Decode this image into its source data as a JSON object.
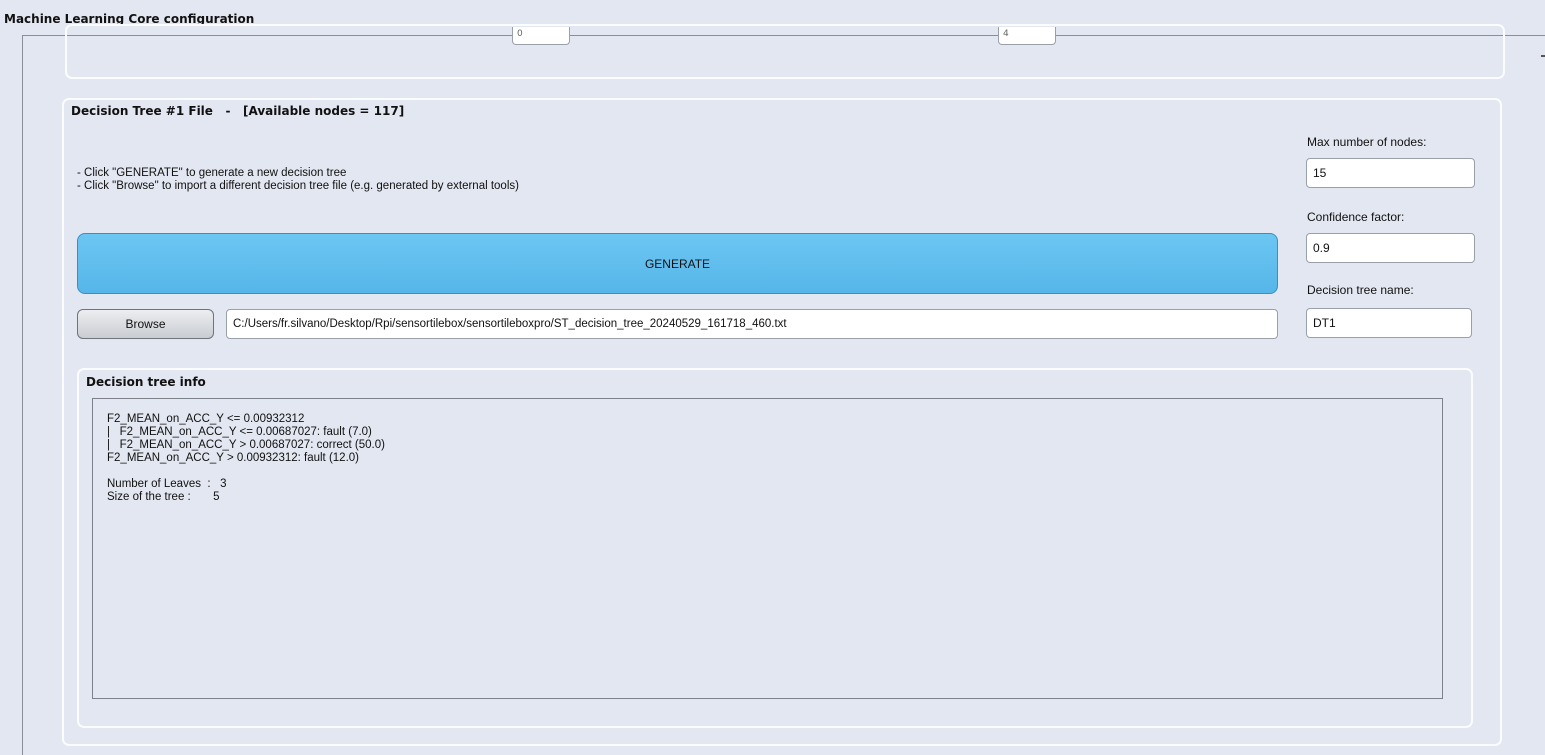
{
  "window": {
    "title": "Machine Learning Core configuration"
  },
  "top_panel": {
    "left_stub_value": "0",
    "right_stub_value": "4"
  },
  "decision_tree_panel": {
    "title": "Decision Tree #1 File   -   [Available nodes = 117]",
    "hint_generate": "- Click \"GENERATE\" to generate a new decision tree",
    "hint_browse": "- Click \"Browse\" to import a different decision tree file (e.g. generated by external tools)",
    "generate_label": "GENERATE",
    "browse_label": "Browse",
    "file_path": "C:/Users/fr.silvano/Desktop/Rpi/sensortilebox/sensortileboxpro/ST_decision_tree_20240529_161718_460.txt",
    "max_nodes_label": "Max number of nodes:",
    "max_nodes_value": "15",
    "confidence_label": "Confidence factor:",
    "confidence_value": "0.9",
    "tree_name_label": "Decision tree name:",
    "tree_name_value": "DT1"
  },
  "decision_tree_info": {
    "title": "Decision tree info",
    "lines": [
      "F2_MEAN_on_ACC_Y <= 0.00932312",
      "|   F2_MEAN_on_ACC_Y <= 0.00687027: fault (7.0)",
      "|   F2_MEAN_on_ACC_Y > 0.00687027: correct (50.0)",
      "F2_MEAN_on_ACC_Y > 0.00932312: fault (12.0)",
      "",
      "Number of Leaves  :   3",
      "Size of the tree :       5"
    ]
  }
}
